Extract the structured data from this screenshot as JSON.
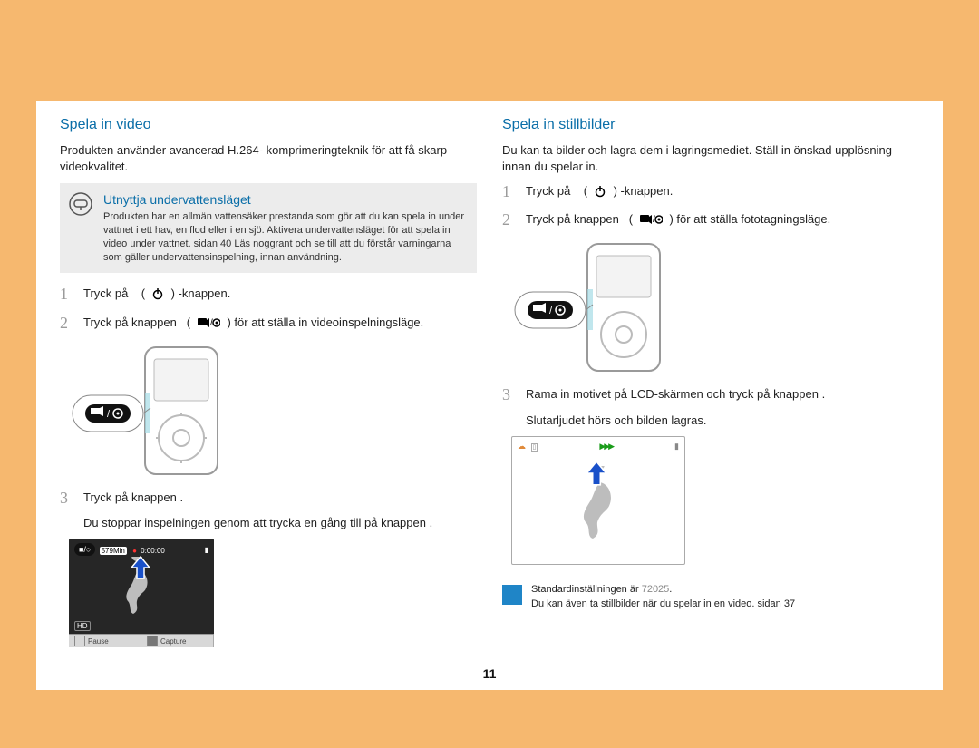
{
  "page_number": "11",
  "left": {
    "heading": "Spela in video",
    "intro": "Produkten använder avancerad H.264- komprimeringteknik för att få skarp videokvalitet.",
    "callout": {
      "title": "Utnyttja undervattensläget",
      "body": "Produkten har en allmän vattensäker prestanda som gör att du kan spela in under vattnet i ett hav, en flod eller i en sjö. Aktivera undervattensläget för att spela in video under vattnet. sidan 40 Läs noggrant och se till att du förstår varningarna som gäller undervattensinspelning, innan användning."
    },
    "steps": {
      "s1_pre": "Tryck på",
      "s1_post": "-knappen.",
      "s2_pre": "Tryck på knappen",
      "s2_post": "för att ställa in videoinspelningsläge.",
      "s3_line": "Tryck på knappen          .",
      "s3_sub": "Du stoppar inspelningen genom att trycka en gång till på knappen         ."
    },
    "preview_bottom": {
      "pause": "Pause",
      "capture": "Capture"
    },
    "preview_top": {
      "min": "579Min",
      "time": "0:00:00"
    }
  },
  "right": {
    "heading": "Spela in stillbilder",
    "intro": "Du kan ta bilder och lagra dem i lagringsmediet. Ställ in önskad upplösning innan du spelar in.",
    "steps": {
      "s1_pre": "Tryck på",
      "s1_post": "-knappen.",
      "s2_pre": "Tryck på knappen",
      "s2_post": "för att ställa fototagningsläge.",
      "s3_line": "Rama in motivet på LCD-skärmen och tryck på knappen      .",
      "s3_sub": "Slutarljudet hörs och bilden lagras."
    },
    "note": {
      "line1_pre": "Standardinställningen är ",
      "line1_val": "72025",
      "line1_post": ".",
      "line2": "Du kan även ta stillbilder när du spelar in en video. sidan 37"
    }
  },
  "icons": {
    "power": "power-icon",
    "mode": "video-photo-mode-icon",
    "goggle": "diving-mask-icon"
  }
}
